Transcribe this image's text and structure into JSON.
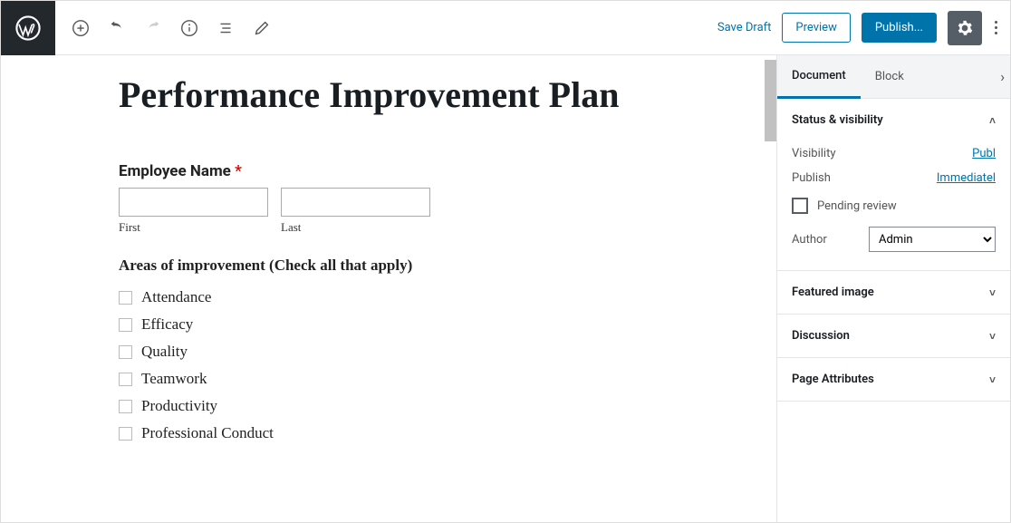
{
  "topbar": {
    "save_draft": "Save Draft",
    "preview": "Preview",
    "publish": "Publish..."
  },
  "editor": {
    "title": "Performance Improvement Plan",
    "employee_name_label": "Employee Name",
    "required_mark": "*",
    "first_sub": "First",
    "last_sub": "Last",
    "areas_label": "Areas of improvement (Check all that apply)",
    "areas": [
      "Attendance",
      "Efficacy",
      "Quality",
      "Teamwork",
      "Productivity",
      "Professional Conduct"
    ]
  },
  "sidebar": {
    "tabs": {
      "document": "Document",
      "block": "Block"
    },
    "status_visibility": "Status & visibility",
    "visibility_label": "Visibility",
    "visibility_value": "Publ",
    "publish_label": "Publish",
    "publish_value": "Immediatel",
    "pending_review": "Pending review",
    "author_label": "Author",
    "author_value": "Admin",
    "featured_image": "Featured image",
    "discussion": "Discussion",
    "page_attributes": "Page Attributes"
  }
}
